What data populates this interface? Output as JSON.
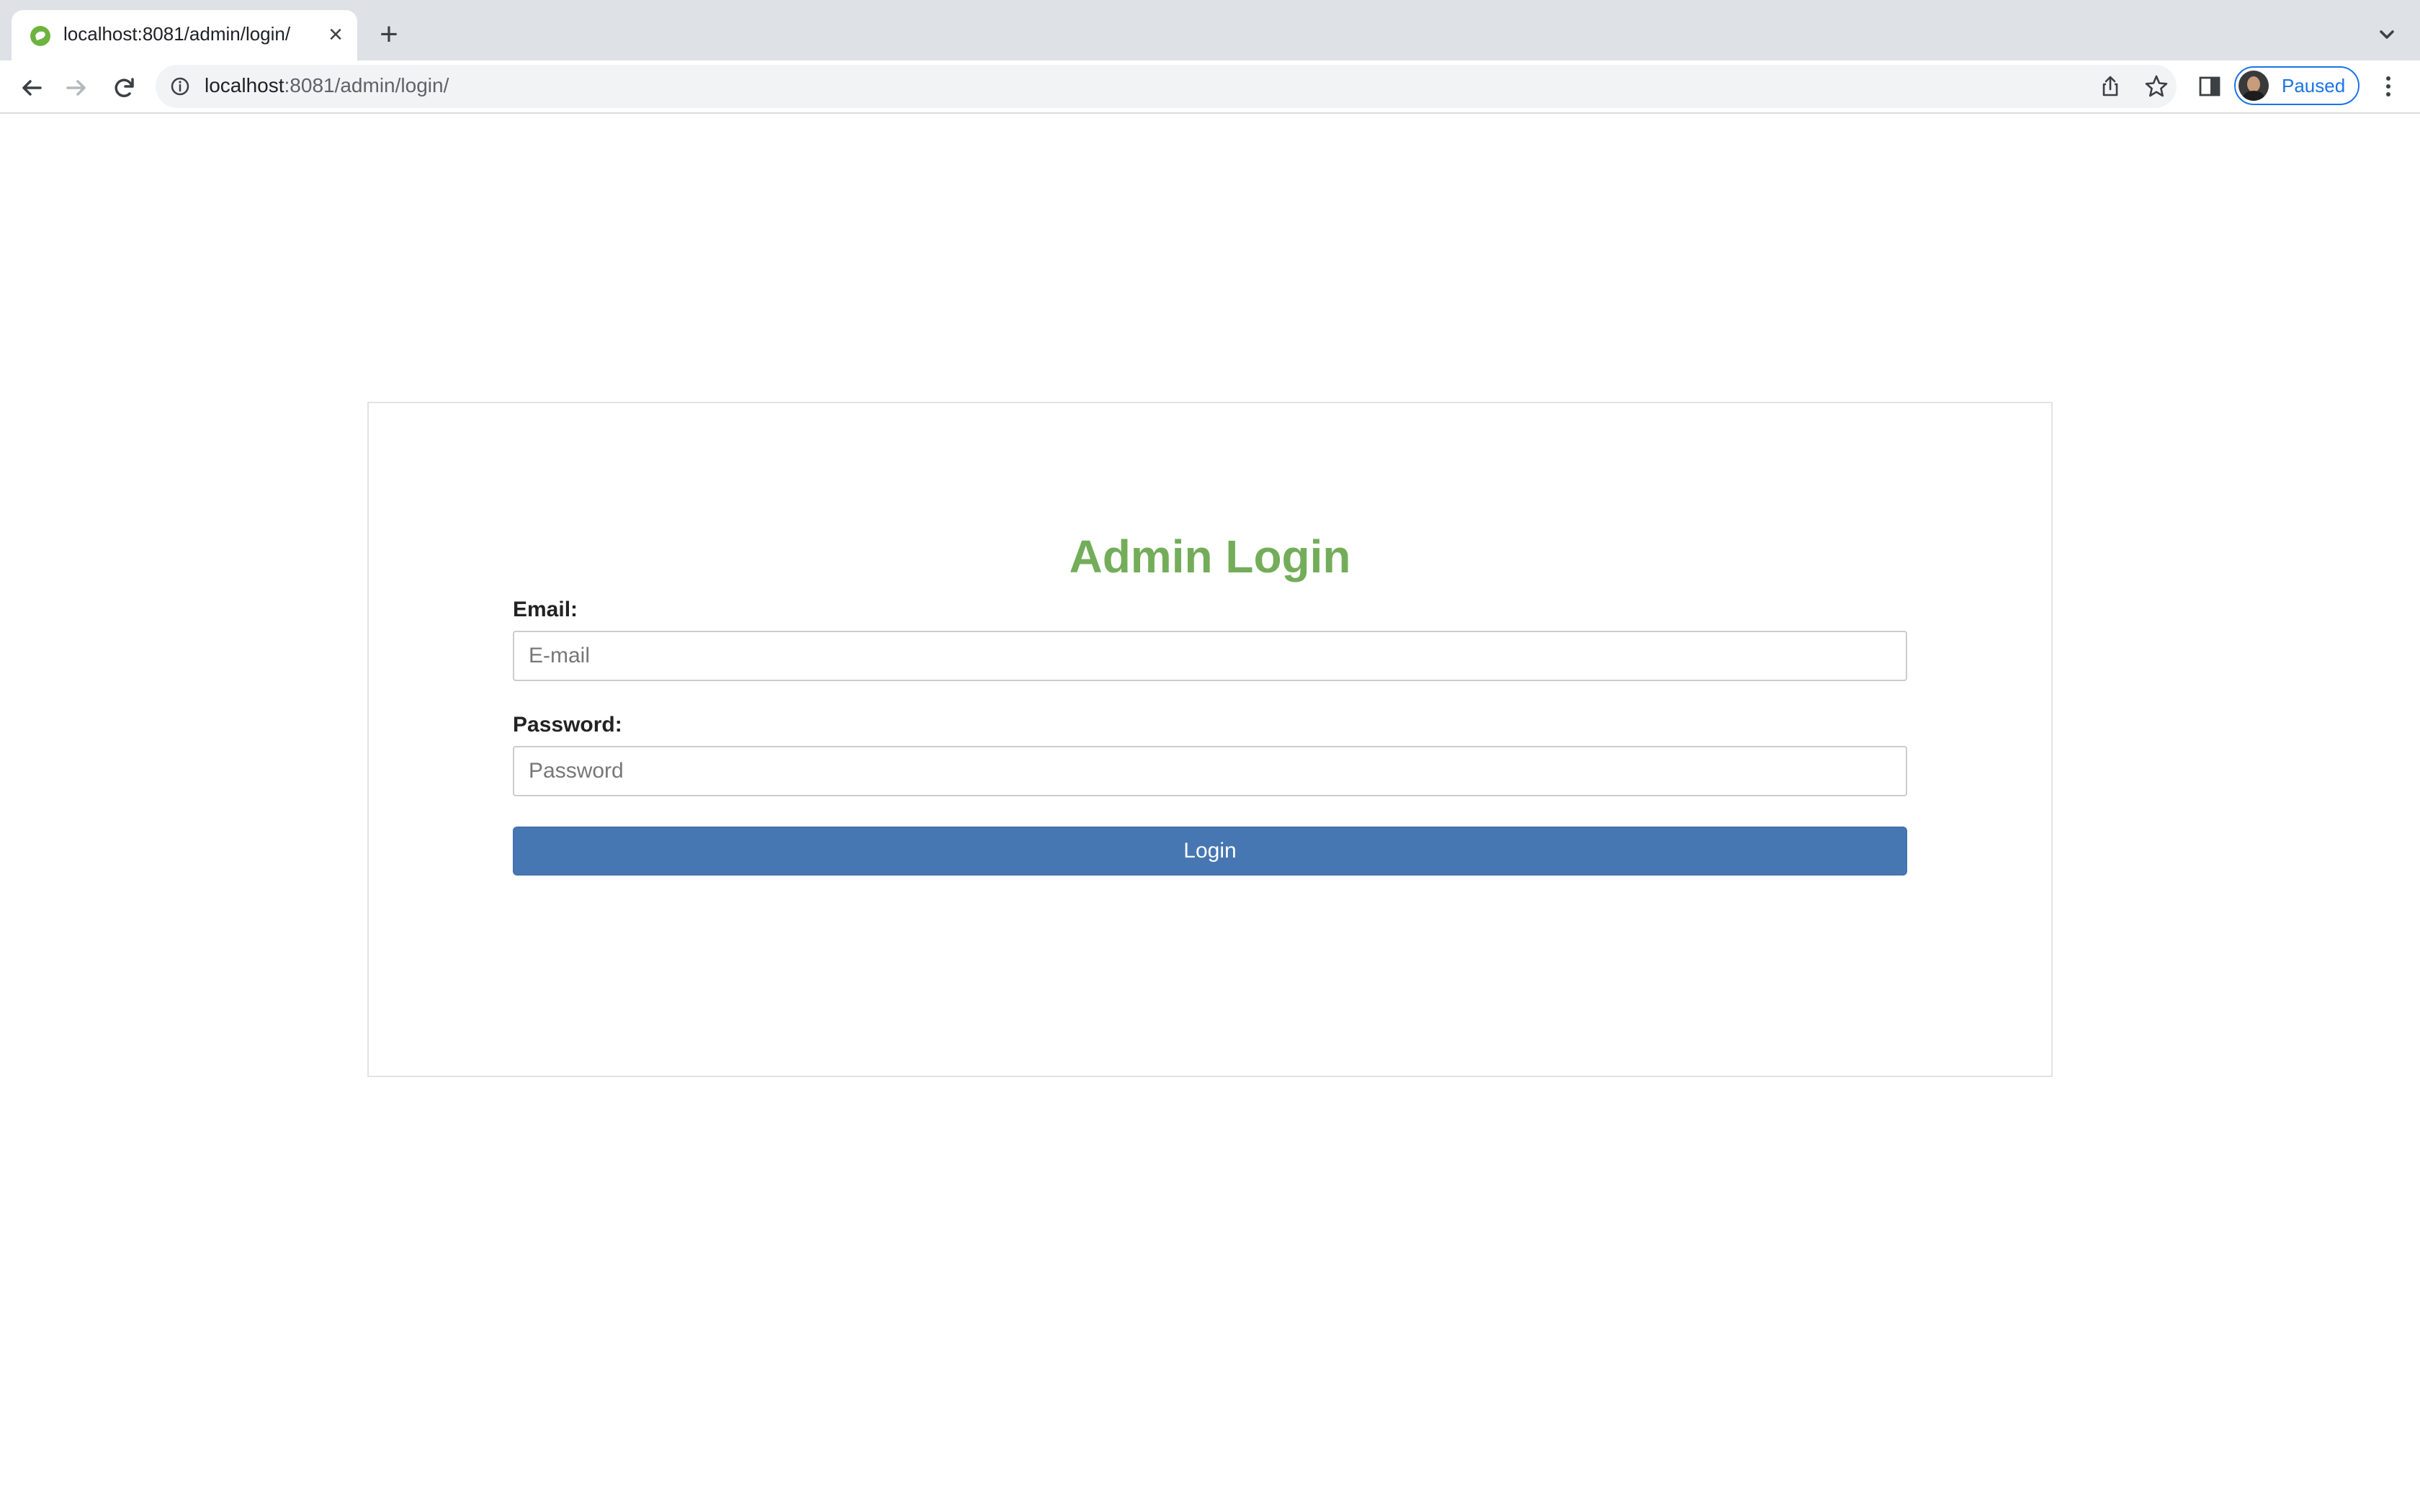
{
  "browser": {
    "tab_title": "localhost:8081/admin/login/",
    "url_host": "localhost",
    "url_rest": ":8081/admin/login/",
    "profile_label": "Paused"
  },
  "colors": {
    "heading": "#74ad5a",
    "button": "#4677b2",
    "favicon": "#6db33f",
    "profile_accent": "#1a73e8"
  },
  "icons": {
    "favicon": "spring-leaf-icon",
    "close_tab": "close-icon",
    "new_tab": "plus-icon",
    "tab_search": "chevron-down-icon",
    "back": "arrow-left-icon",
    "forward": "arrow-right-icon",
    "reload": "reload-icon",
    "site_info": "info-icon",
    "share": "share-icon",
    "bookmark": "star-icon",
    "side_panel": "side-panel-icon",
    "menu": "kebab-menu-icon"
  },
  "login": {
    "title": "Admin Login",
    "email_label": "Email:",
    "email_placeholder": "E-mail",
    "email_value": "",
    "password_label": "Password:",
    "password_placeholder": "Password",
    "password_value": "",
    "submit_label": "Login"
  }
}
